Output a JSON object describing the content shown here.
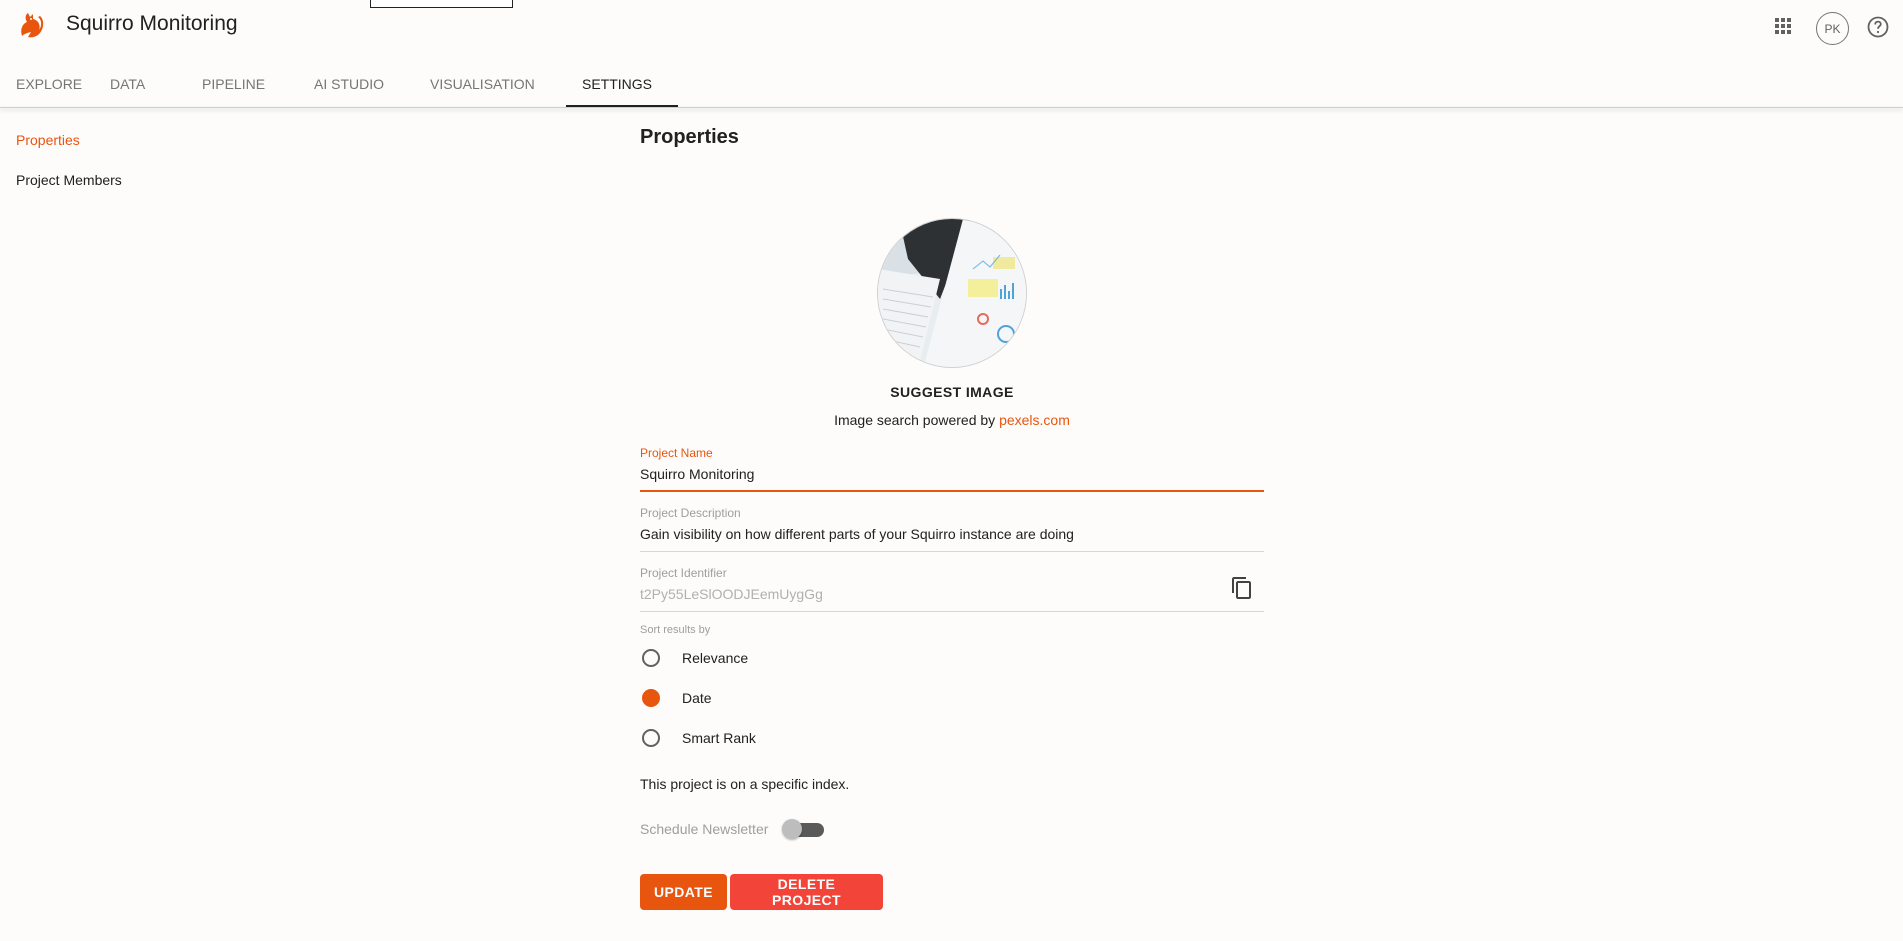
{
  "header": {
    "app_title": "Squirro Monitoring",
    "avatar_initials": "PK",
    "icons": {
      "logo": "squirrel-logo",
      "apps": "apps-grid-icon",
      "help": "help-icon"
    }
  },
  "tabs": [
    {
      "label": "EXPLORE",
      "active": false
    },
    {
      "label": "DATA",
      "active": false
    },
    {
      "label": "PIPELINE",
      "active": false
    },
    {
      "label": "AI STUDIO",
      "active": false
    },
    {
      "label": "VISUALISATION",
      "active": false
    },
    {
      "label": "SETTINGS",
      "active": true
    }
  ],
  "sidebar": {
    "items": [
      {
        "label": "Properties",
        "active": true
      },
      {
        "label": "Project Members",
        "active": false
      }
    ]
  },
  "main": {
    "title": "Properties",
    "suggest_image_label": "SUGGEST IMAGE",
    "powered_prefix": "Image search powered by ",
    "powered_link": "pexels.com",
    "fields": {
      "name": {
        "label": "Project Name",
        "value": "Squirro Monitoring"
      },
      "description": {
        "label": "Project Description",
        "value": "Gain visibility on how different parts of your Squirro instance are doing"
      },
      "identifier": {
        "label": "Project Identifier",
        "value": "t2Py55LeSlOODJEemUygGg"
      }
    },
    "sort": {
      "label": "Sort results by",
      "options": [
        {
          "label": "Relevance",
          "checked": false
        },
        {
          "label": "Date",
          "checked": true
        },
        {
          "label": "Smart Rank",
          "checked": false
        }
      ]
    },
    "index_note": "This project is on a specific index.",
    "newsletter_label": "Schedule Newsletter",
    "newsletter_enabled": false,
    "update_label": "UPDATE",
    "delete_label": "DELETE PROJECT"
  },
  "colors": {
    "accent": "#e8550f",
    "danger": "#f24438",
    "text": "#212121",
    "muted": "#9e9e9e"
  }
}
